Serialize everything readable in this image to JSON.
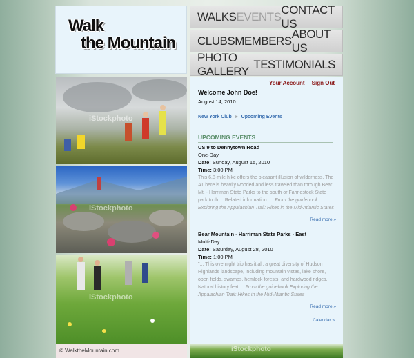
{
  "logo": {
    "line1": "Walk",
    "line2": "the Mountain"
  },
  "nav": {
    "row1": [
      "WALKS",
      "EVENTS",
      "CONTACT US"
    ],
    "row2": [
      "CLUBS",
      "MEMBERS",
      "ABOUT US"
    ],
    "row3": [
      "PHOTO GALLERY",
      "TESTIMONIALS"
    ]
  },
  "account": {
    "your_account": "Your Account",
    "separator": "|",
    "sign_out": "Sign Out"
  },
  "welcome": "Welcome John Doe!",
  "date": "August 14, 2010",
  "breadcrumb": {
    "club": "New York Club",
    "separator": "»",
    "page": "Upcoming Events"
  },
  "section_title": "UPCOMING EVENTS",
  "events": [
    {
      "title": "US 9 to Dennytown Road",
      "duration": "One-Day",
      "date_label": "Date:",
      "date": "Sunday, August 15, 2010",
      "time_label": "Time:",
      "time": "3:00 PM",
      "desc": "This 6.8-mile hike offers the pleasant illusion of wilderness. The AT here is heavily wooded and less traveled than through Bear Mt. - Harriman State Parks to the south or Fahnestock State park to th ... Related information: ...",
      "source": "From the guidebook Exploring the Appalachian Trail: Hikes in the Mid-Atlantic States",
      "more": "Read more »"
    },
    {
      "title": "Bear Mountain - Harriman State Parks - East",
      "duration": "Multi-Day",
      "date_label": "Date:",
      "date": "Saturday, August 28, 2010",
      "time_label": "Time:",
      "time": "1:00 PM",
      "desc": "\"... This overnight trip has it all: a great diversity of Hudson Highlands landscape, including mountain vistas, lake shore, open fields, swamps, hemlock forests, and hardwood ridges. Natural history feat ...",
      "source": "From the guidebook Exploring the Appalachian Trail: Hikes in the Mid-Atlantic States",
      "more": "Read more »"
    }
  ],
  "calendar": "Calendar »",
  "watermark": "iStockphoto",
  "footer": "© WalktheMountain.com"
}
